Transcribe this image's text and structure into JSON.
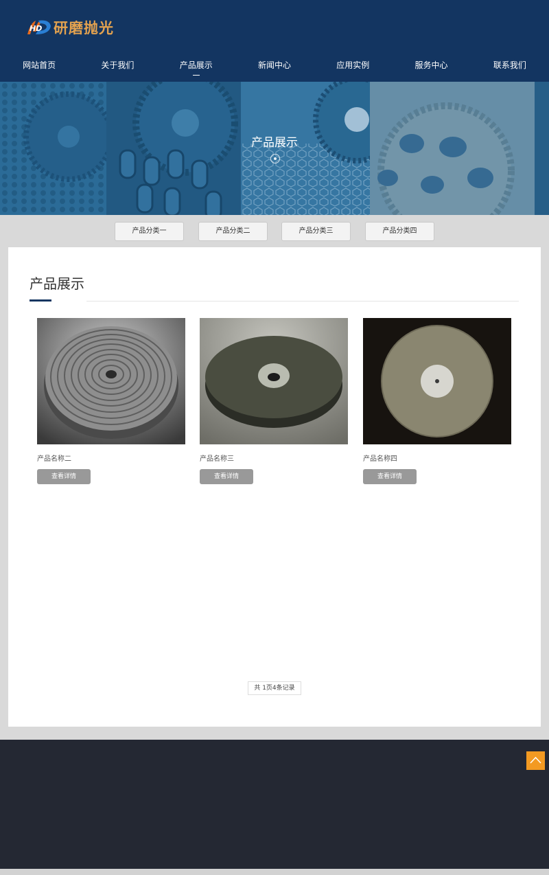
{
  "logo": {
    "mark": "HD",
    "text": "研磨抛光"
  },
  "nav": [
    {
      "label": "网站首页",
      "active": false
    },
    {
      "label": "关于我们",
      "active": false
    },
    {
      "label": "产品展示",
      "active": true
    },
    {
      "label": "新闻中心",
      "active": false
    },
    {
      "label": "应用实例",
      "active": false
    },
    {
      "label": "服务中心",
      "active": false
    },
    {
      "label": "联系我们",
      "active": false
    }
  ],
  "banner": {
    "title": "产品展示"
  },
  "categories": [
    "产品分类一",
    "产品分类二",
    "产品分类三",
    "产品分类四"
  ],
  "section": {
    "title": "产品展示"
  },
  "products": [
    {
      "name": "产品名称二",
      "button": "查看详情"
    },
    {
      "name": "产品名称三",
      "button": "查看详情"
    },
    {
      "name": "产品名称四",
      "button": "查看详情"
    }
  ],
  "pager": {
    "text": "共 1页4条记录"
  },
  "colors": {
    "header_bg": "#133561",
    "logo_text": "#e3a24f",
    "footer_bg": "#242833",
    "to_top": "#f39a22",
    "button_gray": "#999999"
  },
  "icons": {
    "back_to_top": "chevron-up-icon"
  }
}
